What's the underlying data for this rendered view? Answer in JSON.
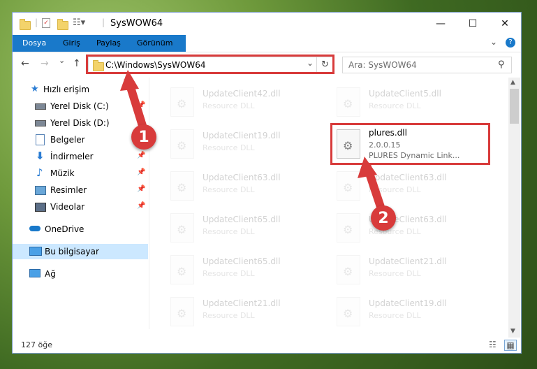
{
  "window": {
    "title": "SysWOW64",
    "controls": {
      "minimize": "—",
      "maximize": "☐",
      "close": "✕"
    }
  },
  "ribbon": {
    "tabs": [
      "Dosya",
      "Giriş",
      "Paylaş",
      "Görünüm"
    ],
    "expand_icon": "chevron-down-icon",
    "help_icon": "help-icon",
    "help_glyph": "?"
  },
  "navigation": {
    "back_glyph": "←",
    "forward_glyph": "→",
    "recent_glyph": "⌄",
    "up_glyph": "↑",
    "address": "C:\\Windows\\SysWOW64",
    "dropdown_glyph": "⌄",
    "refresh_glyph": "↻",
    "search_placeholder": "Ara: SysWOW64",
    "search_glyph": "⚲"
  },
  "sidebar": {
    "items": [
      {
        "label": "Hızlı erişim",
        "icon": "star-icon",
        "pinned": false
      },
      {
        "label": "Yerel Disk (C:)",
        "icon": "drive-icon",
        "pinned": true
      },
      {
        "label": "Yerel Disk (D:)",
        "icon": "drive-icon",
        "pinned": true
      },
      {
        "label": "Belgeler",
        "icon": "documents-icon",
        "pinned": true
      },
      {
        "label": "İndirmeler",
        "icon": "download-icon",
        "pinned": true
      },
      {
        "label": "Müzik",
        "icon": "music-icon",
        "pinned": true
      },
      {
        "label": "Resimler",
        "icon": "pictures-icon",
        "pinned": true
      },
      {
        "label": "Videolar",
        "icon": "videos-icon",
        "pinned": true
      },
      {
        "label": "OneDrive",
        "icon": "cloud-icon",
        "pinned": false
      },
      {
        "label": "Bu bilgisayar",
        "icon": "computer-icon",
        "pinned": false,
        "selected": true
      },
      {
        "label": "Ağ",
        "icon": "network-icon",
        "pinned": false
      }
    ],
    "pin_glyph": "📌"
  },
  "files": {
    "left_column": [
      {
        "name": "UpdateClient42.dll",
        "type": "Resource DLL"
      },
      {
        "name": "UpdateClient19.dll",
        "type": "Resource DLL"
      },
      {
        "name": "UpdateClient63.dll",
        "type": "Resource DLL"
      },
      {
        "name": "UpdateClient65.dll",
        "type": "Resource DLL"
      },
      {
        "name": "UpdateClient65.dll",
        "type": "Resource DLL"
      },
      {
        "name": "UpdateClient21.dll",
        "type": "Resource DLL"
      }
    ],
    "right_column": [
      {
        "name": "UpdateClient5.dll",
        "type": "Resource DLL"
      },
      {
        "name": "UpdateClient63.dll",
        "type": "Resource DLL"
      },
      {
        "name": "UpdateClient63.dll",
        "type": "Resource DLL"
      },
      {
        "name": "UpdateClient21.dll",
        "type": "Resource DLL"
      },
      {
        "name": "UpdateClient19.dll",
        "type": "Resource DLL"
      }
    ],
    "highlighted": {
      "name": "plures.dll",
      "version": "2.0.0.15",
      "description": "PLURES Dynamic Link..."
    }
  },
  "status": {
    "item_count": "127 öğe",
    "details_view_glyph": "☷",
    "icons_view_glyph": "▦"
  },
  "annotations": {
    "badge_1": "1",
    "badge_2": "2",
    "color": "#d83b3b"
  }
}
